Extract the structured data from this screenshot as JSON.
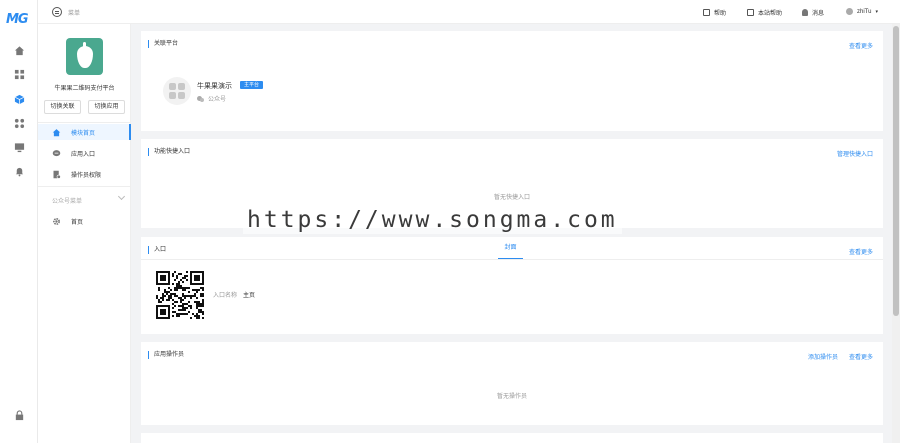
{
  "brand": {
    "logo_text": "MG"
  },
  "topbar": {
    "menu_label": "菜单",
    "help": "帮助",
    "site_help": "本站帮助",
    "messages": "消息",
    "user": "zhiTu"
  },
  "app": {
    "name": "牛果果二维码支付平台",
    "switch_link": "切换关联",
    "switch_app": "切换应用"
  },
  "sidebar": {
    "items": [
      {
        "label": "模块首页"
      },
      {
        "label": "应用入口"
      },
      {
        "label": "操作员权限"
      }
    ],
    "group_label": "公众号菜单",
    "group_items": [
      {
        "label": "首页"
      }
    ]
  },
  "cards": {
    "platform": {
      "title": "关联平台",
      "more": "查看更多",
      "item_name": "牛果果演示",
      "item_tag": "主平台",
      "item_type": "公众号"
    },
    "shortcut": {
      "title": "功能快捷入口",
      "manage": "管理快捷入口",
      "empty": "暂无快捷入口"
    },
    "entry": {
      "title": "入口",
      "tab": "封面",
      "more": "查看更多",
      "label": "入口名称",
      "value": "主页"
    },
    "operators": {
      "title": "应用操作员",
      "add": "添加操作员",
      "more": "查看更多",
      "empty": "暂无操作员"
    }
  },
  "watermark": "https://www.songma.com",
  "colors": {
    "accent": "#2d8cf0",
    "app_logo": "#4aa88f"
  }
}
